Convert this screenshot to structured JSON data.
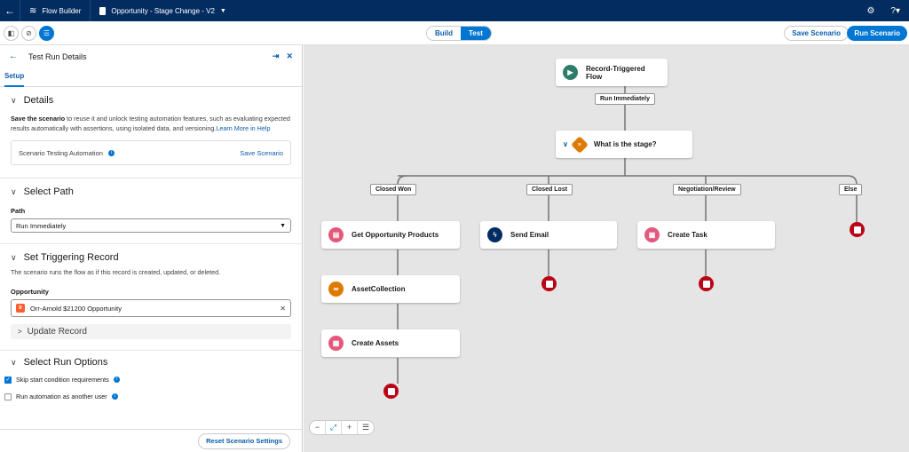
{
  "topbar": {
    "app_name": "Flow Builder",
    "doc_title": "Opportunity - Stage Change - V2"
  },
  "toolbar": {
    "mode_build": "Build",
    "mode_test": "Test",
    "save_scenario": "Save Scenario",
    "run_scenario": "Run Scenario"
  },
  "panel": {
    "title": "Test Run Details",
    "tab": "Setup",
    "details": {
      "heading": "Details",
      "desc_bold": "Save the scenario",
      "desc_rest": " to reuse it and unlock testing automation features, such as evaluating expected results automatically with assertions, using isolated data, and versioning.",
      "learn_more": "Learn More in Help",
      "card_label": "Scenario Testing Automation",
      "card_link": "Save Scenario"
    },
    "path": {
      "heading": "Select Path",
      "label": "Path",
      "value": "Run Immediately"
    },
    "trigger": {
      "heading": "Set Triggering Record",
      "desc": "The scenario runs the flow as if this record is created, updated, or deleted.",
      "label": "Opportunity",
      "record": "Orr-Arnold $21200 Opportunity",
      "update_record": "Update Record"
    },
    "run_options": {
      "heading": "Select Run Options",
      "opt1": "Skip start condition requirements",
      "opt2": "Run automation as another user"
    },
    "reset": "Reset Scenario Settings"
  },
  "canvas": {
    "start": "Record-Triggered Flow",
    "run_immediately": "Run Immediately",
    "decision": "What is the stage?",
    "branches": [
      "Closed Won",
      "Closed Lost",
      "Negotiation/Review",
      "Else"
    ],
    "get_products": "Get Opportunity Products",
    "asset_collection": "AssetCollection",
    "create_assets": "Create Assets",
    "send_email": "Send Email",
    "create_task": "Create Task"
  },
  "colors": {
    "nav": "#032d60",
    "brand": "#0176d3",
    "start_icon": "#2e7d6b",
    "decision_icon": "#dd7a01",
    "record_icon": "#e3587c",
    "action_icon": "#032d60",
    "end": "#ba0517"
  }
}
